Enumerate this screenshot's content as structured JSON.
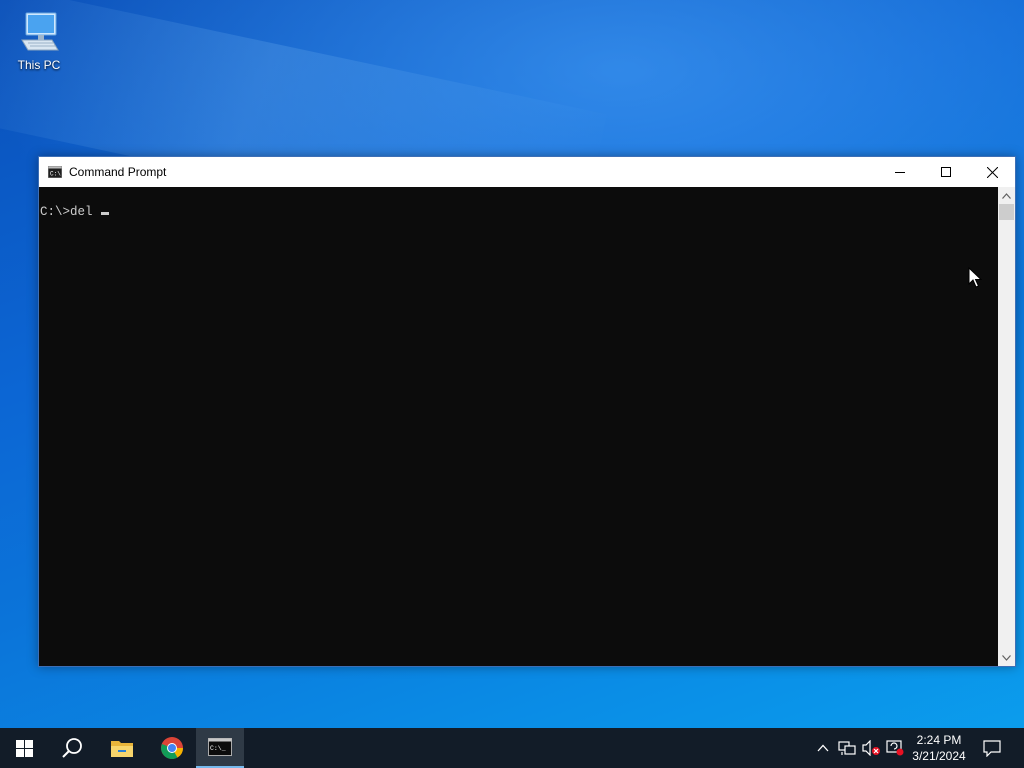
{
  "desktop": {
    "icons": [
      {
        "label": "This PC",
        "icon": "computer-icon"
      }
    ]
  },
  "window": {
    "title": "Command Prompt",
    "icon": "cmd-icon",
    "controls": {
      "minimize": "minimize-icon",
      "maximize": "maximize-icon",
      "close": "close-icon"
    }
  },
  "console": {
    "prompt": "C:\\>",
    "command": "del "
  },
  "taskbar": {
    "items": [
      {
        "name": "start",
        "icon": "windows-icon"
      },
      {
        "name": "search",
        "icon": "search-icon"
      },
      {
        "name": "file-explorer",
        "icon": "folder-icon"
      },
      {
        "name": "chrome",
        "icon": "chrome-icon"
      },
      {
        "name": "command-prompt",
        "icon": "cmd-icon",
        "active": true
      }
    ],
    "tray": {
      "icons": [
        "chevron-up-icon",
        "network-icon",
        "volume-muted-icon",
        "security-icon"
      ],
      "time": "2:24 PM",
      "date": "3/21/2024",
      "notification_icon": "notification-icon"
    }
  },
  "colors": {
    "console_bg": "#0c0c0c",
    "console_fg": "#cccccc",
    "taskbar_bg": "#121c28",
    "active_indicator": "#76b9ed"
  }
}
